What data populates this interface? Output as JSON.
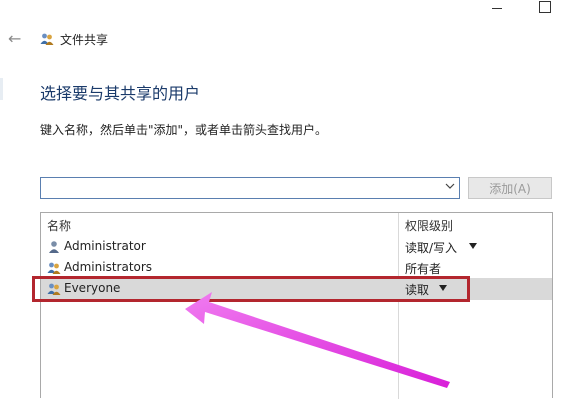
{
  "window": {
    "title": "文件共享"
  },
  "dialog": {
    "heading": "选择要与其共享的用户",
    "hint": "键入名称，然后单击\"添加\"，或者单击箭头查找用户。",
    "combo_value": "",
    "add_button": "添加(A)"
  },
  "list": {
    "columns": {
      "name": "名称",
      "permission": "权限级别"
    },
    "rows": [
      {
        "name": "Administrator",
        "permission": "读取/写入",
        "has_dropdown": true,
        "icon": "single-user-icon"
      },
      {
        "name": "Administrators",
        "permission": "所有者",
        "has_dropdown": false,
        "icon": "user-group-icon"
      },
      {
        "name": "Everyone",
        "permission": "读取",
        "has_dropdown": true,
        "icon": "user-group-icon",
        "selected": true
      }
    ]
  },
  "annotation": {
    "highlight_color": "#b3262e",
    "arrow_color": "#e436e6"
  }
}
